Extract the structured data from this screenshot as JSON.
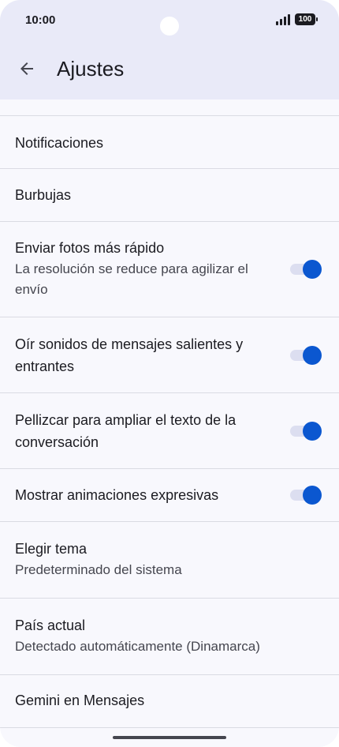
{
  "status_bar": {
    "time": "10:00",
    "battery": "100"
  },
  "header": {
    "title": "Ajustes"
  },
  "items": [
    {
      "title": "Notificaciones",
      "summary": ""
    },
    {
      "title": "Burbujas",
      "summary": ""
    },
    {
      "title": "Enviar fotos más rápido",
      "summary": "La resolución se reduce para agilizar el envío",
      "toggle": true
    },
    {
      "title": "Oír sonidos de mensajes salientes y entrantes",
      "summary": "",
      "toggle": true
    },
    {
      "title": "Pellizcar para ampliar el texto de la conversación",
      "summary": "",
      "toggle": true
    },
    {
      "title": "Mostrar animaciones expresivas",
      "summary": "",
      "toggle": true
    },
    {
      "title": "Elegir tema",
      "summary": "Predeterminado del sistema"
    },
    {
      "title": "País actual",
      "summary": "Detectado automáticamente (Dinamarca)"
    },
    {
      "title": "Gemini en Mensajes",
      "summary": ""
    }
  ],
  "colors": {
    "accent": "#0b57d0",
    "app_bar": "#e9eaf8",
    "background": "#f8f8fd"
  },
  "icons": {
    "back": "arrow-back-icon"
  }
}
